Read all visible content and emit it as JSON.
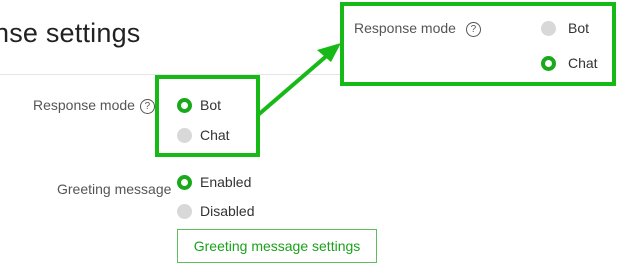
{
  "page": {
    "title": "nse settings"
  },
  "response_mode": {
    "label": "Response mode",
    "help_icon": "?",
    "options": [
      {
        "label": "Bot",
        "selected": true
      },
      {
        "label": "Chat",
        "selected": false
      }
    ]
  },
  "greeting": {
    "label": "Greeting message",
    "options": [
      {
        "label": "Enabled",
        "selected": true
      },
      {
        "label": "Disabled",
        "selected": false
      }
    ],
    "settings_button": "Greeting message settings"
  },
  "zoom_callout": {
    "label": "Response mode",
    "help_icon": "?",
    "options": [
      {
        "label": "Bot",
        "selected": false
      },
      {
        "label": "Chat",
        "selected": true
      }
    ]
  },
  "colors": {
    "accent": "#17b917",
    "radio_on": "#1aa91a",
    "radio_off": "#d8d8d8"
  }
}
